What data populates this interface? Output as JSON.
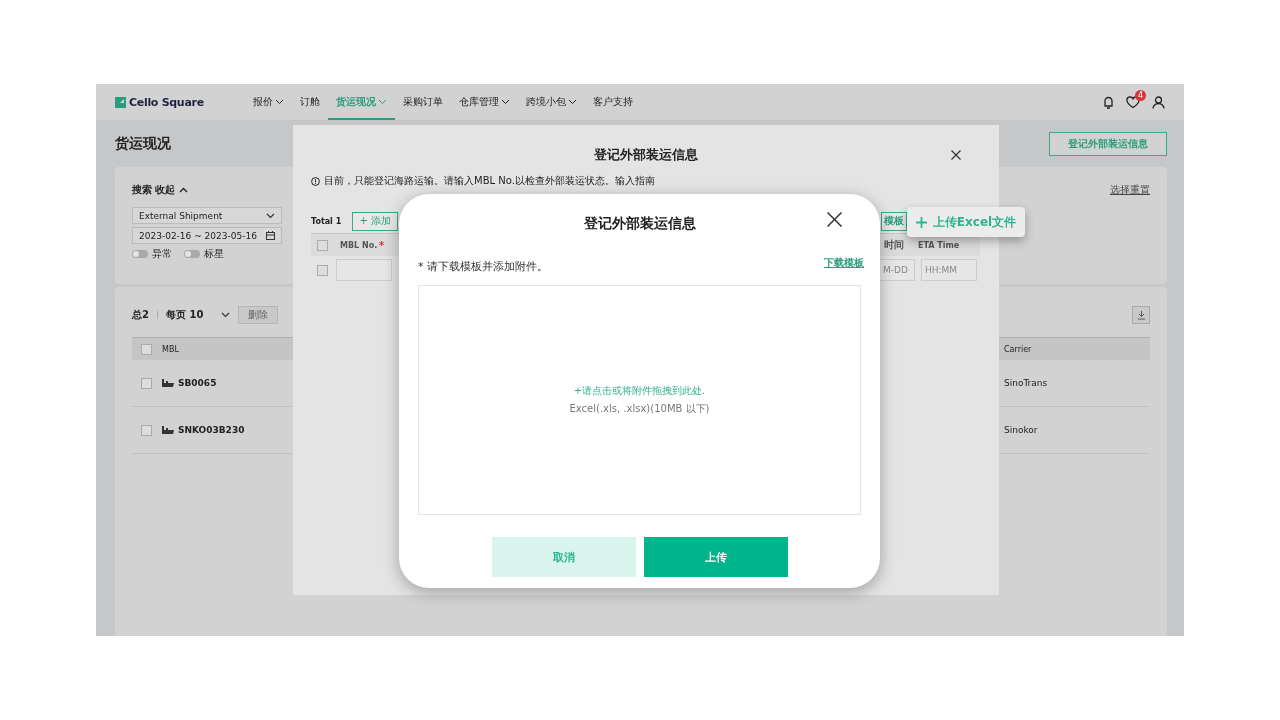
{
  "app": {
    "logo": "Cello Square",
    "nav": [
      {
        "label": "报价",
        "dropdown": true,
        "selected": false
      },
      {
        "label": "订舱",
        "dropdown": false,
        "selected": false
      },
      {
        "label": "货运现况",
        "dropdown": true,
        "selected": true
      },
      {
        "label": "采购订单",
        "dropdown": false,
        "selected": false
      },
      {
        "label": "仓库管理",
        "dropdown": true,
        "selected": false
      },
      {
        "label": "跨境小包",
        "dropdown": true,
        "selected": false
      },
      {
        "label": "客户支持",
        "dropdown": false,
        "selected": false
      }
    ],
    "notification_badge": "4"
  },
  "page": {
    "title": "货运现况",
    "register_button": "登记外部装运信息"
  },
  "search": {
    "toggle_label": "搜索 收起",
    "expanded": true,
    "shipment_type": "External Shipment",
    "date_range": "2023-02-16 ~ 2023-05-16",
    "switches": [
      {
        "label": "异常",
        "on": false
      },
      {
        "label": "标星",
        "on": false
      }
    ],
    "reset_link": "选择重置"
  },
  "results": {
    "select_all_checked": false,
    "total": "总2",
    "page_size": "每页 10",
    "delete_button": "删除",
    "columns": [
      "MBL",
      "Carrier"
    ],
    "rows": [
      {
        "mbl": "SB0065",
        "carrier": "SinoTrans",
        "checked": false
      },
      {
        "mbl": "SNKO03B230",
        "carrier": "Sinokor",
        "checked": false
      }
    ]
  },
  "register_dialog": {
    "select_all_checked": false,
    "title": "登记外部装运信息",
    "notice": "目前，只能登记海路运输。请输入MBL No.以检查外部装运状态。输入指南",
    "total": "Total 1",
    "add_button": "+ 添加",
    "template_button": "模板",
    "columns": [
      {
        "label": "MBL No.",
        "required": true
      },
      {
        "label": "时间",
        "required": false
      },
      {
        "label": "ETA Time",
        "required": false
      }
    ],
    "row": {
      "checked": false,
      "placeholders": [
        "M-DD",
        "HH:MM"
      ]
    }
  },
  "upload_dialog": {
    "title": "登记外部装运信息",
    "instruction": "* 请下载模板并添加附件。",
    "template_link": "下载模板",
    "drop_text": "+请点击或将附件拖拽到此处.",
    "drop_hint": "Excel(.xls, .xlsx)(10MB 以下)",
    "cancel_button": "取消",
    "upload_button": "上传"
  },
  "callout": {
    "label": "上传Excel文件"
  }
}
